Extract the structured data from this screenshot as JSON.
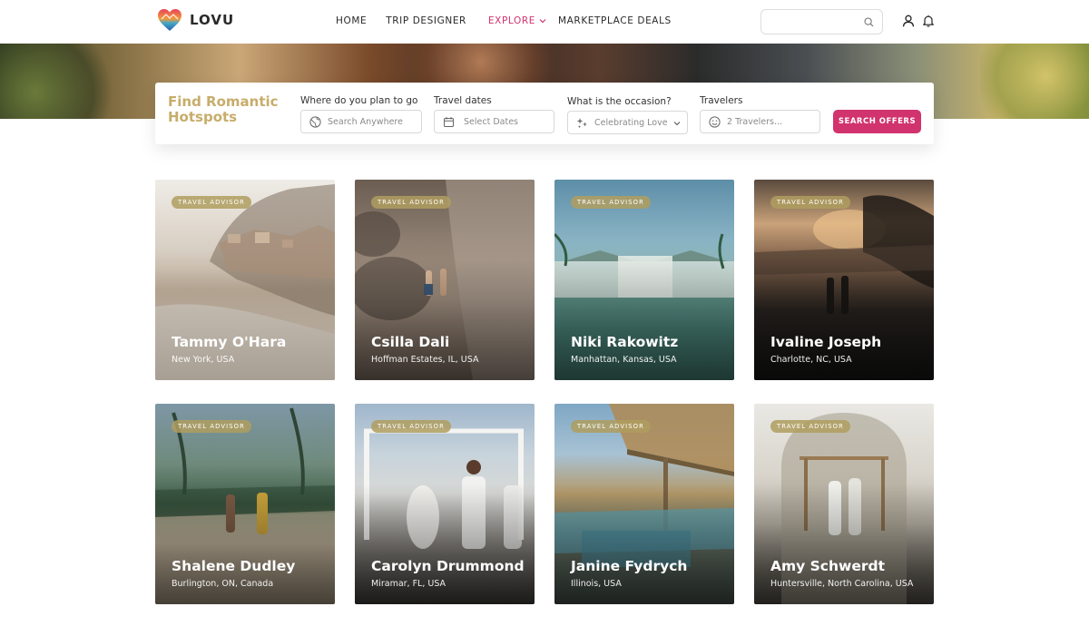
{
  "brand": {
    "name": "LOVU"
  },
  "nav": {
    "items": [
      {
        "label": "HOME"
      },
      {
        "label": "TRIP DESIGNER"
      },
      {
        "label": "EXPLORE",
        "active": true
      },
      {
        "label": "MARKETPLACE DEALS"
      }
    ]
  },
  "header": {
    "search_placeholder": "",
    "icons": [
      "search-icon",
      "user-icon",
      "bell-icon"
    ]
  },
  "search_panel": {
    "title": "Find Romantic Hotspots",
    "destination": {
      "label": "Where do you plan to go",
      "placeholder": "Search Anywhere",
      "icon": "globe-icon"
    },
    "dates": {
      "label": "Travel dates",
      "placeholder": "Select Dates",
      "icon": "calendar-icon"
    },
    "occasion": {
      "label": "What is the occasion?",
      "value": "Celebrating Love",
      "icon": "sparkle-icon"
    },
    "travelers": {
      "label": "Travelers",
      "placeholder": "2 Travelers...",
      "icon": "smile-icon"
    },
    "button": "SEARCH OFFERS"
  },
  "colors": {
    "accent": "#d1336e",
    "gold": "#c7ad6b",
    "badge": "#af9e5f"
  },
  "advisors": [
    {
      "badge": "TRAVEL ADVISOR",
      "name": "Tammy O'Hara",
      "location": "New York, USA"
    },
    {
      "badge": "TRAVEL ADVISOR",
      "name": "Csilla Dali",
      "location": "Hoffman Estates, IL, USA"
    },
    {
      "badge": "TRAVEL ADVISOR",
      "name": "Niki Rakowitz",
      "location": "Manhattan, Kansas, USA"
    },
    {
      "badge": "TRAVEL ADVISOR",
      "name": "Ivaline Joseph",
      "location": "Charlotte, NC, USA"
    },
    {
      "badge": "TRAVEL ADVISOR",
      "name": "Shalene Dudley",
      "location": "Burlington, ON, Canada"
    },
    {
      "badge": "TRAVEL ADVISOR",
      "name": "Carolyn Drummond",
      "location": "Miramar, FL, USA"
    },
    {
      "badge": "TRAVEL ADVISOR",
      "name": "Janine Fydrych",
      "location": "Illinois, USA"
    },
    {
      "badge": "TRAVEL ADVISOR",
      "name": "Amy Schwerdt",
      "location": "Huntersville, North Carolina, USA"
    }
  ]
}
